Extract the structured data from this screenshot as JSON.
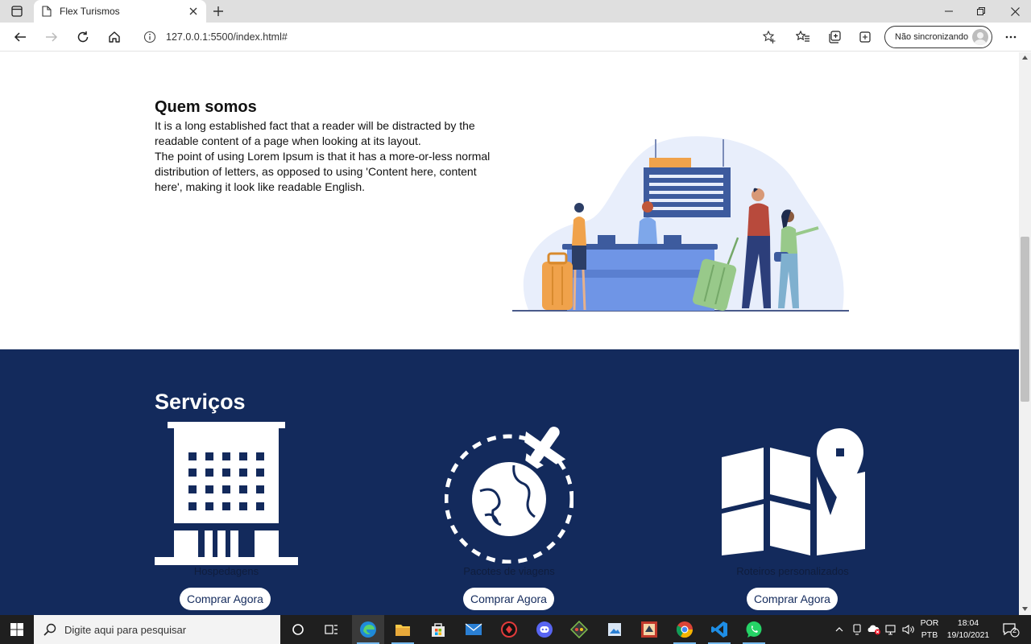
{
  "browser": {
    "tab_title": "Flex Turismos",
    "url": "127.0.0.1:5500/index.html#",
    "profile_label": "Não sincronizando"
  },
  "page": {
    "about": {
      "title": "Quem somos",
      "paragraph_1": "It is a long established fact that a reader will be distracted by the readable content of a page when looking at its layout.",
      "paragraph_2": "The point of using Lorem Ipsum is that it has a more-or-less normal distribution of letters, as opposed to using 'Content here, content here', making it look like readable English."
    },
    "services": {
      "title": "Serviços",
      "items": [
        {
          "label": "Hospedagens",
          "button": "Comprar Agora",
          "icon": "hotel-building-icon"
        },
        {
          "label": "Pacotes de viagens",
          "button": "Comprar Agora",
          "icon": "globe-airplane-icon"
        },
        {
          "label": "Roteiros personalizados",
          "button": "Comprar Agora",
          "icon": "map-pin-icon"
        }
      ]
    }
  },
  "taskbar": {
    "search_placeholder": "Digite aqui para pesquisar",
    "language": "POR",
    "keyboard": "PTB",
    "time": "18:04",
    "date": "19/10/2021",
    "notification_count": "2"
  },
  "colors": {
    "services_bg": "#132a5c",
    "accent_blue": "#3d5b9e"
  }
}
